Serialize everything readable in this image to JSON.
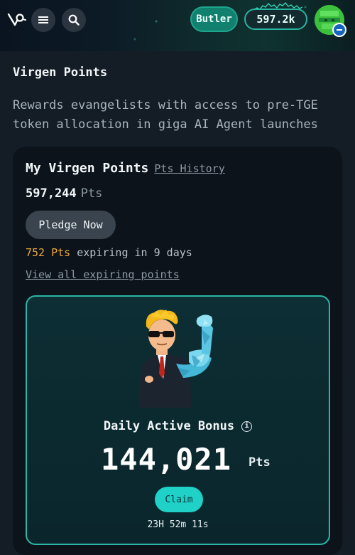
{
  "header": {
    "logo_icon": "virgen-logo-icon",
    "menu_icon": "hamburger-menu-icon",
    "search_icon": "search-icon",
    "butler_label": "Butler",
    "balance": "597.2k",
    "avatar_icon": "pixel-avatar",
    "avatar_badge_icon": "minus-badge-icon"
  },
  "page": {
    "title": "Virgen Points",
    "subtitle": "Rewards evangelists with access to pre-TGE token allocation in giga AI Agent launches"
  },
  "card": {
    "title": "My Virgen Points",
    "history_link": "Pts History",
    "points_value": "597,244",
    "points_unit": "Pts",
    "pledge_label": "Pledge Now",
    "expiring_amount": "752 Pts",
    "expiring_text": "expiring in 9 days",
    "view_expiring_link": "View all expiring points"
  },
  "bonus": {
    "title": "Daily Active Bonus",
    "amount": "144,021",
    "unit": "Pts",
    "claim_label": "Claim",
    "countdown": "23H 52m 11s"
  },
  "colors": {
    "accent_teal": "#1fd1c7",
    "butler_green": "#12806f",
    "expiring_orange": "#f0a93a",
    "card_bg": "#0c131b",
    "page_bg": "#141d25"
  }
}
